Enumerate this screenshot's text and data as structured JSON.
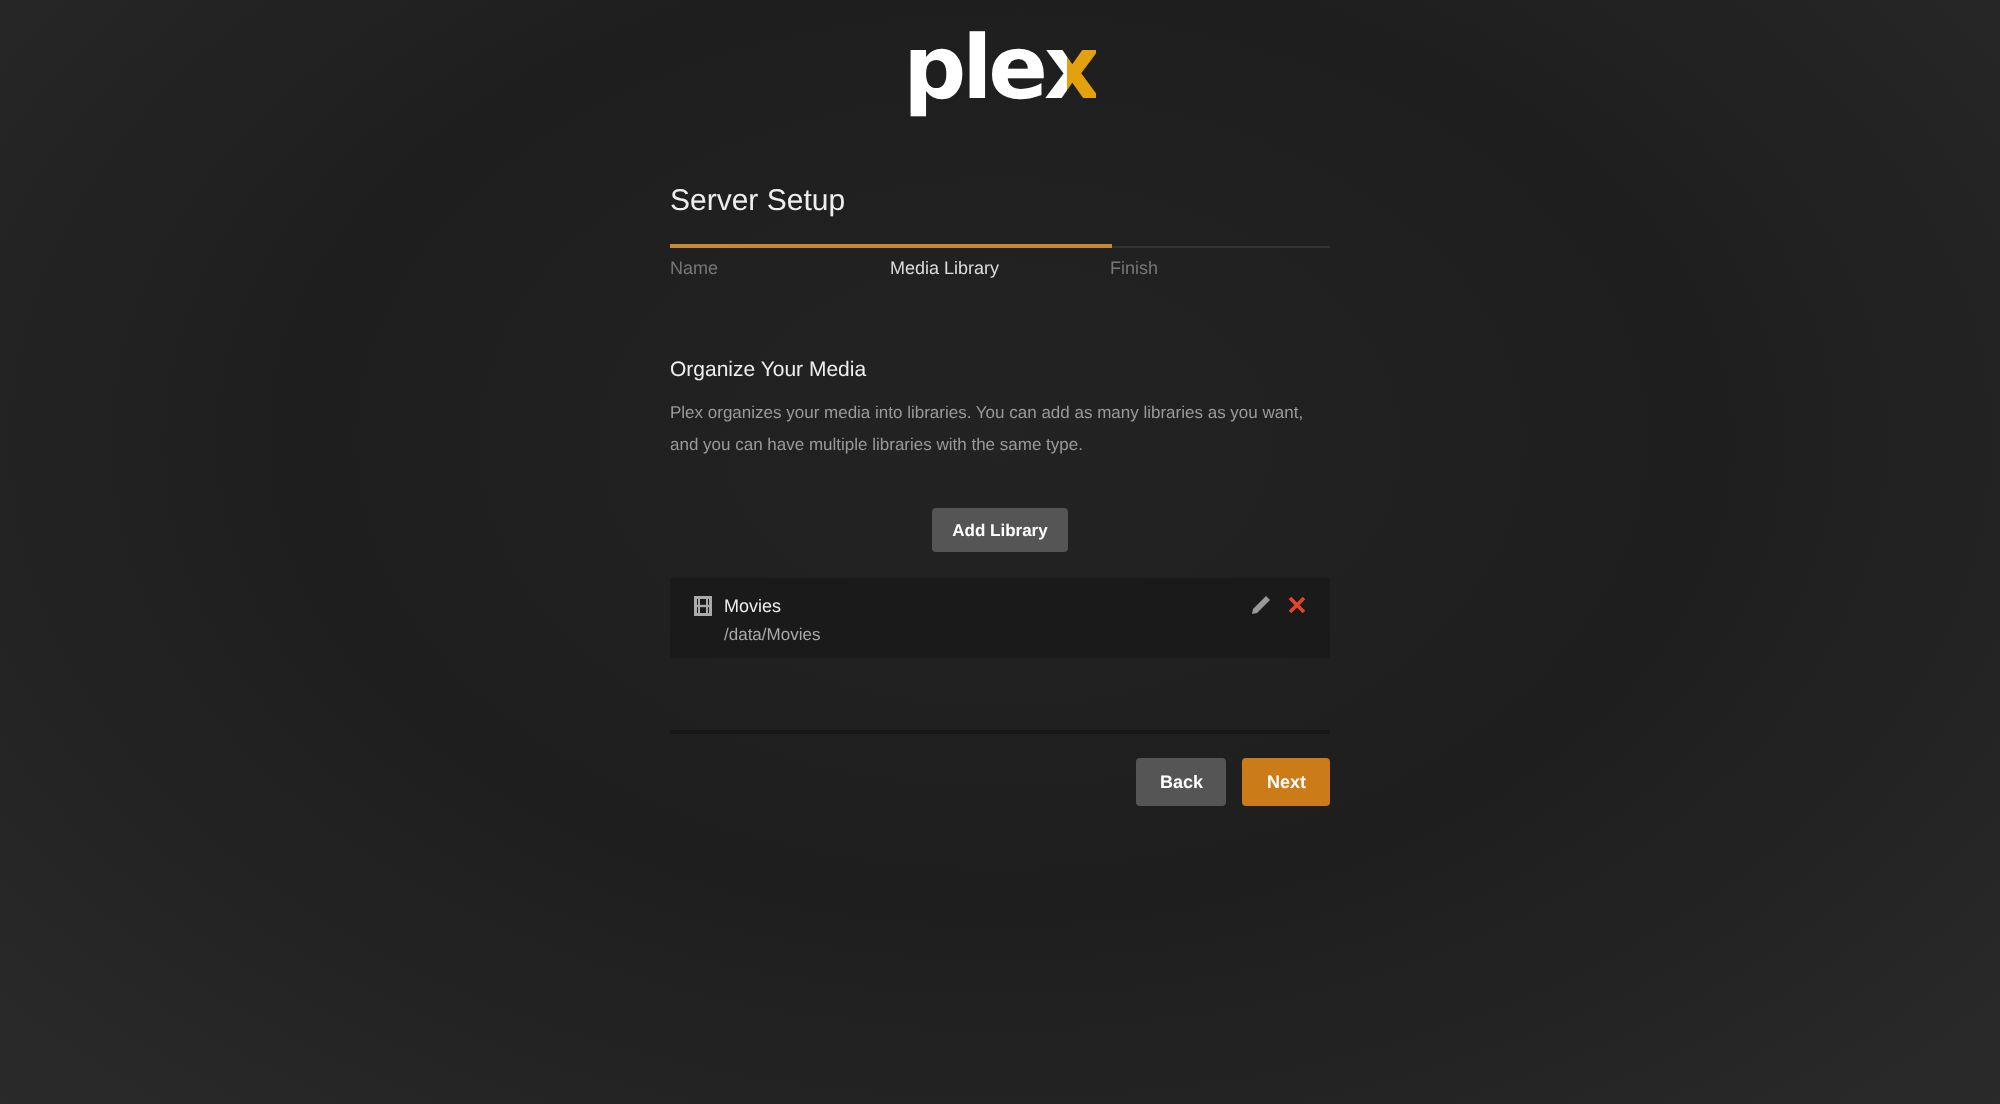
{
  "logo": "plex",
  "title": "Server Setup",
  "progress": {
    "level": 0.67
  },
  "steps": [
    {
      "label": "Name",
      "selected": false
    },
    {
      "label": "Media Library",
      "selected": true
    },
    {
      "label": "Finish",
      "selected": false
    }
  ],
  "section": {
    "heading": "Organize Your Media",
    "description": "Plex organizes your media into libraries. You can add as many libraries as you want, and you can have multiple libraries with the same type."
  },
  "add_button": "Add Library",
  "libraries": [
    {
      "kind": "movie",
      "name": "Movies",
      "path": "/data/Movies"
    }
  ],
  "buttons": [
    {
      "label": "Back",
      "kind": "secondary"
    },
    {
      "label": "Next",
      "kind": "primary"
    }
  ]
}
